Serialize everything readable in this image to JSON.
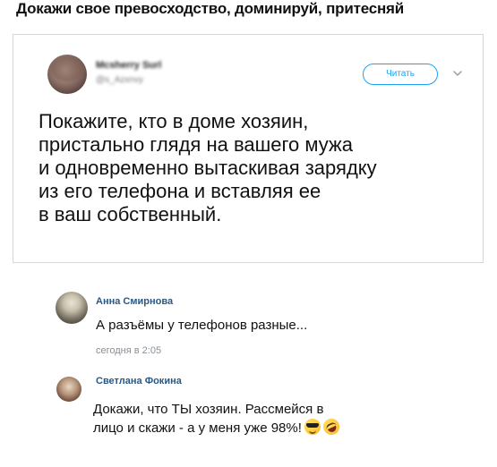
{
  "headline": "Докажи свое превосходство, доминируй, притесняй",
  "tweet": {
    "author_name": "Mcsherry Surl",
    "author_handle": "@s_Azxnvy",
    "follow_label": "Читать",
    "text": "Покажите, кто в доме хозяин,\nпристально глядя на вашего мужа\nи одновременно вытаскивая зарядку\nиз его телефона и вставляя ее\nв ваш собственный."
  },
  "comments": [
    {
      "author": "Анна Смирнова",
      "text": "А разъёмы у телефонов разные...",
      "date": "сегодня в 2:05"
    },
    {
      "author": "Светлана Фокина",
      "text_line1": "Докажи, что ТЫ хозяин. Рассмейся в",
      "text_line2": "лицо и скажи - а у меня уже 98%!",
      "emojis": [
        "smiling-face-with-sunglasses-icon",
        "rolling-on-floor-laughing-icon"
      ]
    }
  ],
  "colors": {
    "accent": "#1da1f2",
    "author_link": "#2a5885",
    "muted": "#8a8f96",
    "border": "#d6d6d6"
  }
}
